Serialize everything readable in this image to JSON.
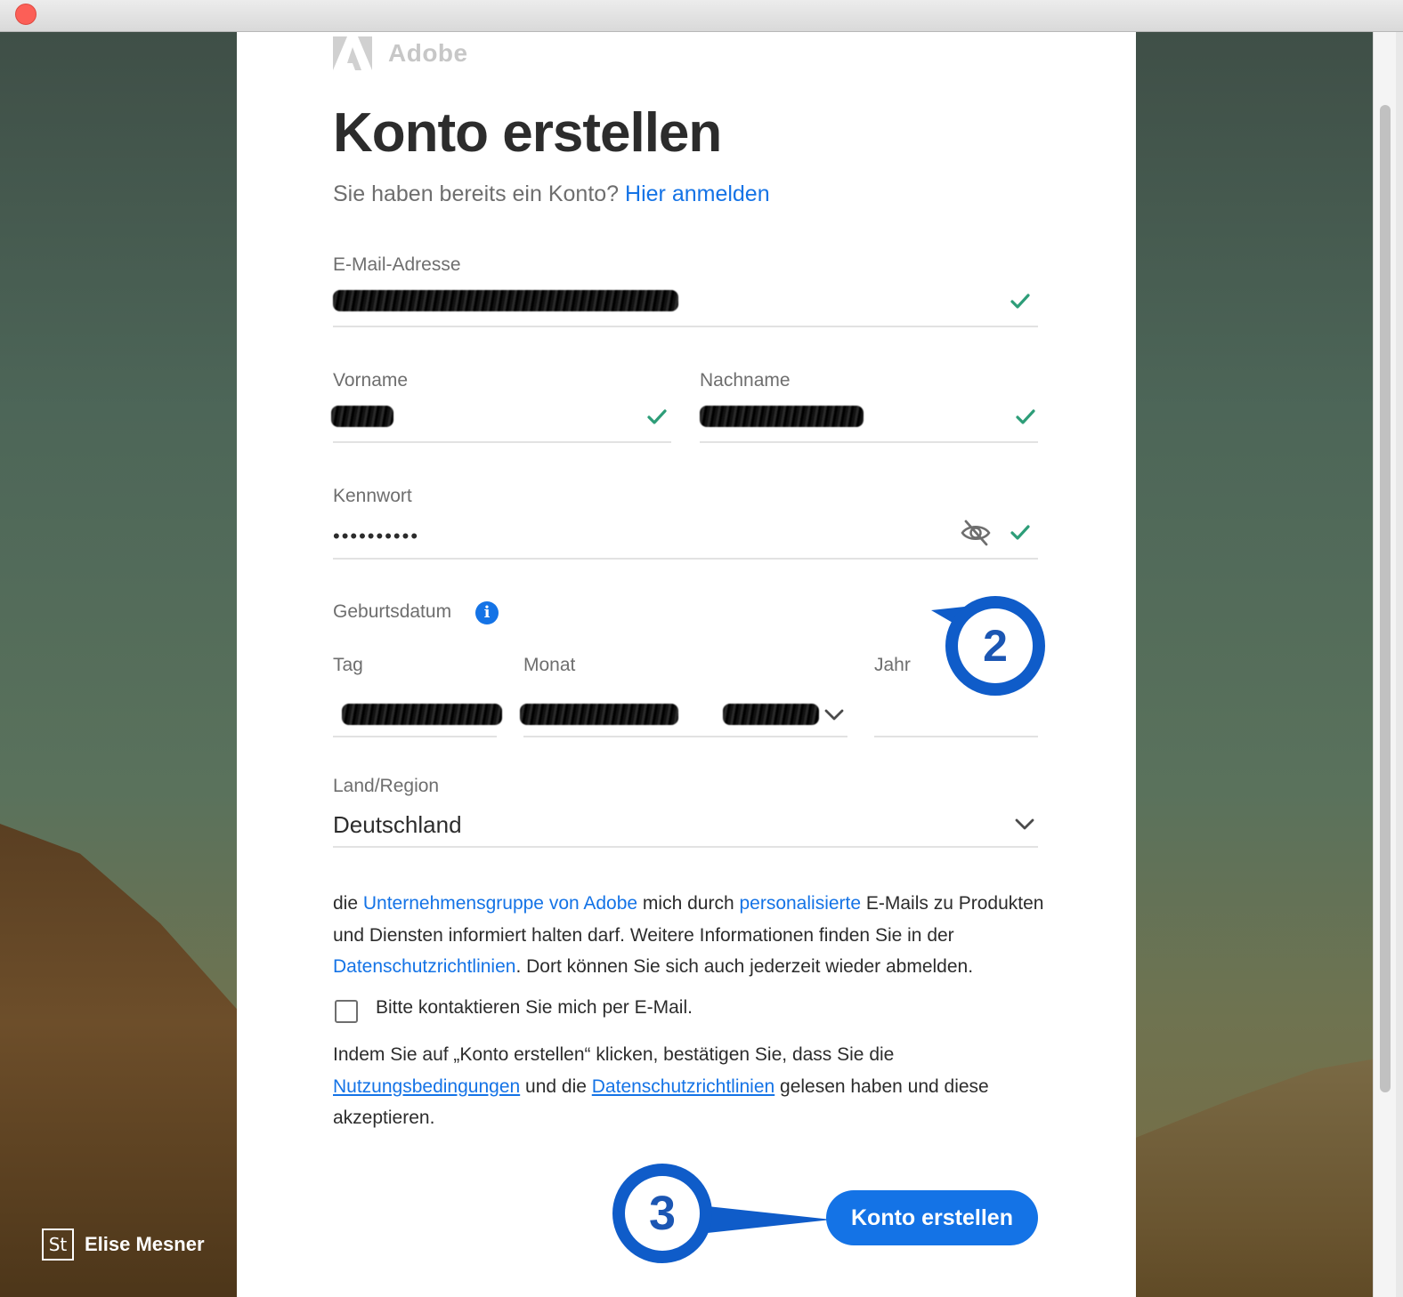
{
  "logo": {
    "text": "Adobe"
  },
  "form": {
    "title": "Konto erstellen",
    "subtitle_text": "Sie haben bereits ein Konto?",
    "subtitle_link": "Hier anmelden",
    "email": {
      "label": "E-Mail-Adresse"
    },
    "firstname": {
      "label": "Vorname"
    },
    "lastname": {
      "label": "Nachname"
    },
    "password": {
      "label": "Kennwort",
      "value": "••••••••••"
    },
    "birthdate": {
      "label": "Geburtsdatum",
      "day_label": "Tag",
      "month_label": "Monat",
      "year_label": "Jahr"
    },
    "country": {
      "label": "Land/Region",
      "value": "Deutschland"
    },
    "marketing": {
      "t1": "die ",
      "l1": "Unternehmensgruppe von Adobe",
      "t2": " mich durch ",
      "l2": "personalisierte",
      "t3": " E-Mails zu Produkten und Diensten informiert halten darf. Weitere Informationen finden Sie in der ",
      "l3": "Datenschutzrichtlinien",
      "t4": ". Dort können Sie sich auch jederzeit wieder abmelden."
    },
    "contact_checkbox_label": "Bitte kontaktieren Sie mich per E-Mail.",
    "terms": {
      "t1": "Indem Sie auf „Konto erstellen“ klicken, bestätigen Sie, dass Sie die ",
      "l1": "Nutzungsbedingungen",
      "t2": " und die ",
      "l2": "Datenschutzrichtlinien",
      "t3": " gelesen haben und diese akzeptieren."
    },
    "submit_label": "Konto erstellen"
  },
  "callouts": {
    "step2": "2",
    "step3": "3"
  },
  "stock": {
    "badge": "St",
    "name": "Elise Mesner"
  },
  "colors": {
    "accent": "#1473e6",
    "success": "#2d9d78",
    "callout": "#0f5cc9"
  },
  "icons": [
    "adobe-logo-icon",
    "check-icon",
    "eye-off-icon",
    "info-icon",
    "chevron-down-icon",
    "checkbox-icon"
  ]
}
